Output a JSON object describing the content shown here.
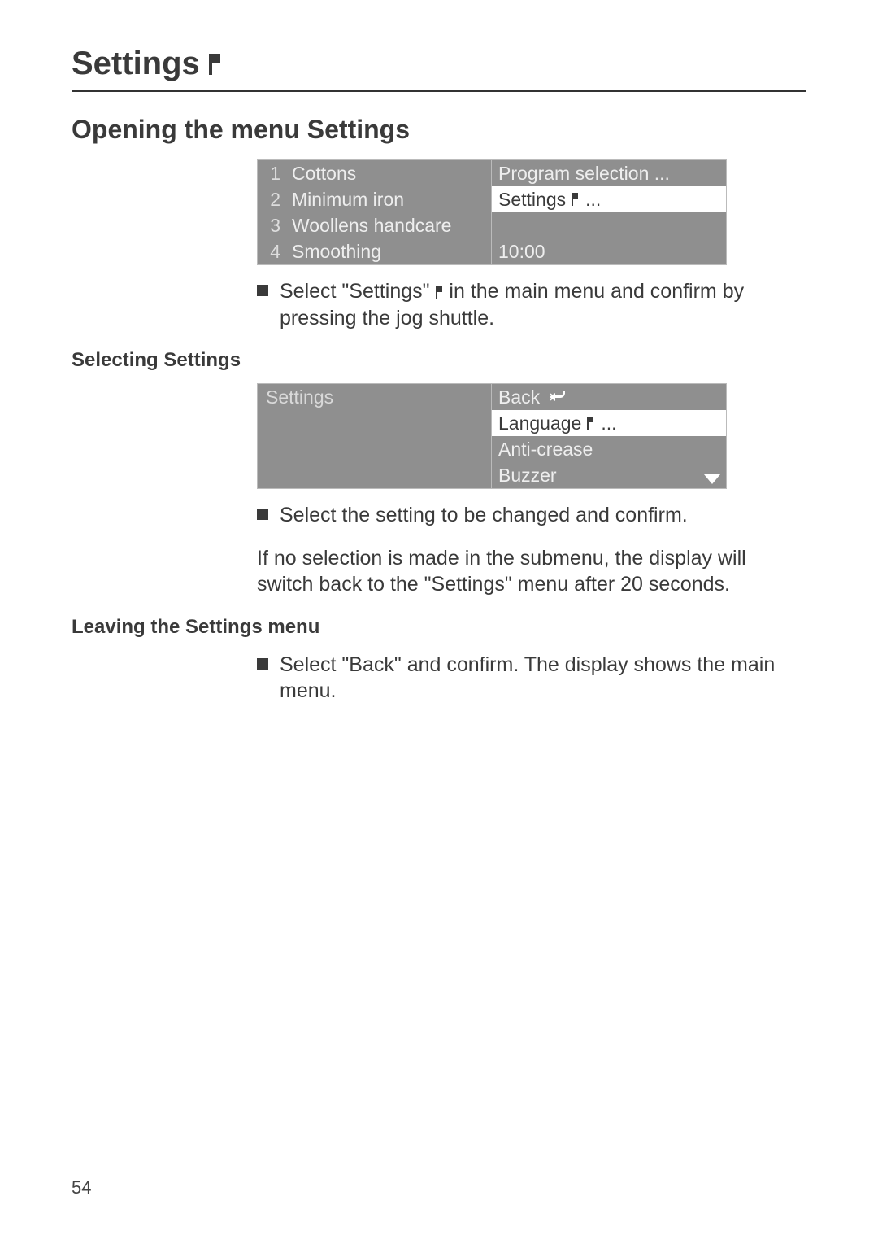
{
  "page": {
    "title": "Settings",
    "number": "54"
  },
  "sections": {
    "opening": {
      "heading": "Opening the menu Settings",
      "display": {
        "left": [
          {
            "num": "1",
            "label": "Cottons"
          },
          {
            "num": "2",
            "label": "Minimum iron"
          },
          {
            "num": "3",
            "label": "Woollens handcare"
          },
          {
            "num": "4",
            "label": "Smoothing"
          }
        ],
        "right": {
          "program_selection": "Program selection ...",
          "settings_item": "Settings",
          "settings_suffix": "...",
          "time": "10:00"
        }
      },
      "bullet_pre": "Select \"Settings\" ",
      "bullet_post": " in the main menu and confirm by pressing the jog shuttle."
    },
    "selecting": {
      "heading": "Selecting Settings",
      "display": {
        "left_title": "Settings",
        "right": {
          "back": "Back",
          "language": "Language",
          "language_suffix": "...",
          "anti_crease": "Anti-crease",
          "buzzer": "Buzzer"
        }
      },
      "bullet": "Select the setting to be changed and confirm.",
      "note": "If no selection is made in the submenu, the display will switch back to the \"Settings\" menu after 20 seconds."
    },
    "leaving": {
      "heading": "Leaving the Settings menu",
      "bullet": "Select \"Back\" and confirm. The display shows the main menu."
    }
  }
}
